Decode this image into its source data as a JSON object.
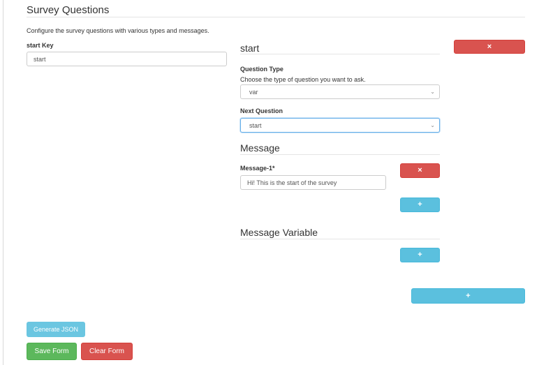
{
  "page": {
    "title": "Survey Questions",
    "description": "Configure the survey questions with various types and messages."
  },
  "key_field": {
    "label": "start Key",
    "value": "start"
  },
  "question": {
    "heading": "start",
    "delete_icon": "×",
    "type": {
      "label": "Question Type",
      "help": "Choose the type of question you want to ask.",
      "selected": "var"
    },
    "next": {
      "label": "Next Question",
      "selected": "start"
    },
    "message": {
      "heading": "Message",
      "items": [
        {
          "label": "Message-1*",
          "value": "Hi! This is the start of the survey",
          "delete_icon": "×"
        }
      ],
      "add_icon": "+"
    },
    "message_variable": {
      "heading": "Message Variable",
      "add_icon": "+"
    }
  },
  "add_question_icon": "+",
  "footer": {
    "generate_label": "Generate JSON",
    "save_label": "Save Form",
    "clear_label": "Clear Form"
  },
  "colors": {
    "danger": "#d9534f",
    "info": "#5bc0de",
    "success": "#5cb85c"
  }
}
